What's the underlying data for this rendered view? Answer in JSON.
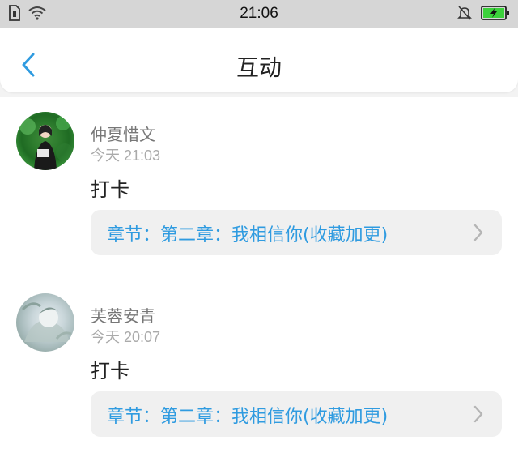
{
  "status_bar": {
    "time": "21:06"
  },
  "header": {
    "title": "互动"
  },
  "items": [
    {
      "username": "仲夏惜文",
      "timestamp": "今天 21:03",
      "content": "打卡",
      "chapter": "章节：第二章：我相信你(收藏加更)"
    },
    {
      "username": "芙蓉安青",
      "timestamp": "今天 20:07",
      "content": "打卡",
      "chapter": "章节：第二章：我相信你(收藏加更)"
    }
  ],
  "colors": {
    "accent": "#2f9be0",
    "status_bar_bg": "#d6d6d6",
    "card_bg": "#f0f0f0",
    "battery_green": "#3bd13b"
  },
  "icons": [
    "sim-icon",
    "wifi-icon",
    "silent-bell-icon",
    "battery-charging-icon",
    "back-chevron-icon",
    "chevron-right-icon"
  ]
}
